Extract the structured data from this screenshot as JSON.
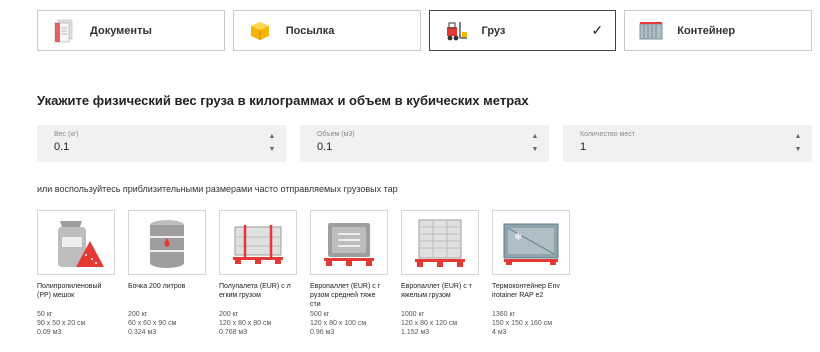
{
  "tabs": [
    {
      "label": "Документы",
      "icon": "documents-icon",
      "active": false
    },
    {
      "label": "Посылка",
      "icon": "parcel-box-icon",
      "active": false
    },
    {
      "label": "Груз",
      "icon": "forklift-icon",
      "active": true
    },
    {
      "label": "Контейнер",
      "icon": "container-icon",
      "active": false
    }
  ],
  "heading": "Укажите физический вес груза в килограммах и объем в кубических метрах",
  "fields": {
    "weight": {
      "label": "Вес (кг)",
      "value": "0.1"
    },
    "volume": {
      "label": "Объем (м3)",
      "value": "0.1"
    },
    "places": {
      "label": "Количество мест",
      "value": "1"
    }
  },
  "hint": "или воспользуйтесь приблизительными размерами часто отправляемых грузовых тар",
  "packages": [
    {
      "name": "Полипропиленовый (PP) мешок",
      "weight": "50 кг",
      "dims": "90 x 50 x 20 см",
      "volume": "0.09 м3",
      "icon": "sack-icon"
    },
    {
      "name": "Бочка 200 литров",
      "weight": "200 кг",
      "dims": "60 x 60 x 90 см",
      "volume": "0.324 м3",
      "icon": "barrel-icon"
    },
    {
      "name": "Полупалета (EUR) с л егким грузом",
      "weight": "200 кг",
      "dims": "120 x 80 x 80 см",
      "volume": "0.768 м3",
      "icon": "half-pallet-icon"
    },
    {
      "name": "Европаллет (EUR) с г рузом средней тяже сти",
      "weight": "500 кг",
      "dims": "120 x 80 x 100 см",
      "volume": "0.96 м3",
      "icon": "euro-pallet-medium-icon"
    },
    {
      "name": "Европаллет (EUR) с т яжелым грузом",
      "weight": "1000 кг",
      "dims": "120 x 80 x 120 см",
      "volume": "1.152 м3",
      "icon": "euro-pallet-heavy-icon"
    },
    {
      "name": "Термоконтейнер Env irotainer RAP e2",
      "weight": "1360 кг",
      "dims": "150 x 150 x 160 см",
      "volume": "4 м3",
      "icon": "thermo-container-icon"
    }
  ],
  "colors": {
    "accent": "#e53935",
    "field_bg": "#f1f1f1",
    "border": "#c9c9c9"
  }
}
